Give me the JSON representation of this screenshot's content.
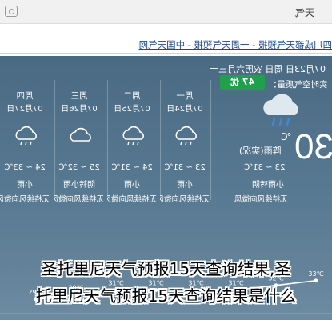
{
  "browser": {
    "tab_title": "天气"
  },
  "breadcrumb": "四川成都天气预报 - 一周天气预报 - 中国天气网",
  "today": {
    "header": "07月23日 周日 农历六月三十",
    "aqi_label": "实时空气质量：",
    "aqi_value": "47 优",
    "temperature": "30",
    "unit": "℃",
    "condition_now": "阵雨(实况)",
    "temp_range": "23 ~ 31℃",
    "condition": "小雨转阴",
    "wind": "无持续风向微风"
  },
  "forecast": [
    {
      "dow": "周一",
      "date": "07月24日",
      "temp_range": "23 ~ 31℃",
      "condition": "小雨",
      "wind": "无持续风向微风"
    },
    {
      "dow": "周二",
      "date": "07月25日",
      "temp_range": "24 ~ 31℃",
      "condition": "小雨",
      "wind": "无持续风向微风"
    },
    {
      "dow": "周三",
      "date": "07月26日",
      "temp_range": "25 ~ 32℃",
      "condition": "阴转小雨",
      "wind": "无持续风向微风"
    },
    {
      "dow": "周四",
      "date": "07月27日",
      "temp_range": "24 ~ 33℃",
      "condition": "小雨",
      "wind": "无持续风向微风"
    }
  ],
  "chart_data": {
    "type": "line",
    "series": [
      {
        "values": [
          29,
          30,
          31,
          31,
          31,
          31,
          32,
          33
        ]
      }
    ],
    "point_labels": [
      "29℃",
      "30℃",
      "31℃",
      "31℃",
      "31℃",
      "31℃",
      "32℃",
      "33℃"
    ]
  },
  "colors": {
    "panel": "#4f6f86",
    "aqi_badge": "#21a04b"
  },
  "overlay": {
    "line1": "圣托里尼天气预报15天查询结果,圣",
    "line2": "托里尼天气预报15天查询结果是什么"
  }
}
